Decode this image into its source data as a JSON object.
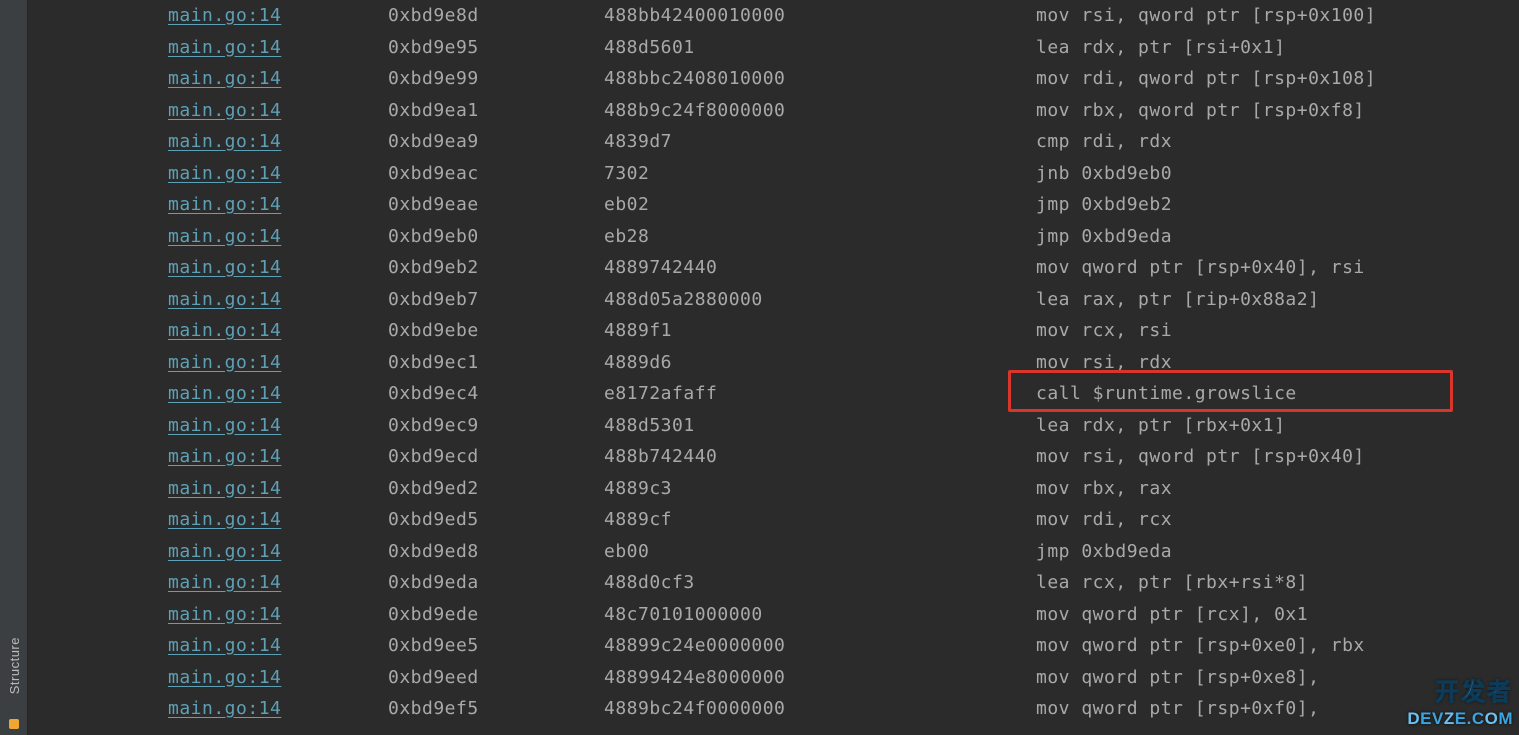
{
  "sidebar": {
    "structure_label": "Structure"
  },
  "highlight_row_index": 12,
  "rows": [
    {
      "src": "main.go:14",
      "addr": "0xbd9e8d",
      "bytes": "488bb42400010000",
      "asm": "mov rsi, qword ptr [rsp+0x100]"
    },
    {
      "src": "main.go:14",
      "addr": "0xbd9e95",
      "bytes": "488d5601",
      "asm": "lea rdx, ptr [rsi+0x1]"
    },
    {
      "src": "main.go:14",
      "addr": "0xbd9e99",
      "bytes": "488bbc2408010000",
      "asm": "mov rdi, qword ptr [rsp+0x108]"
    },
    {
      "src": "main.go:14",
      "addr": "0xbd9ea1",
      "bytes": "488b9c24f8000000",
      "asm": "mov rbx, qword ptr [rsp+0xf8]"
    },
    {
      "src": "main.go:14",
      "addr": "0xbd9ea9",
      "bytes": "4839d7",
      "asm": "cmp rdi, rdx"
    },
    {
      "src": "main.go:14",
      "addr": "0xbd9eac",
      "bytes": "7302",
      "asm": "jnb 0xbd9eb0"
    },
    {
      "src": "main.go:14",
      "addr": "0xbd9eae",
      "bytes": "eb02",
      "asm": "jmp 0xbd9eb2"
    },
    {
      "src": "main.go:14",
      "addr": "0xbd9eb0",
      "bytes": "eb28",
      "asm": "jmp 0xbd9eda"
    },
    {
      "src": "main.go:14",
      "addr": "0xbd9eb2",
      "bytes": "4889742440",
      "asm": "mov qword ptr [rsp+0x40], rsi"
    },
    {
      "src": "main.go:14",
      "addr": "0xbd9eb7",
      "bytes": "488d05a2880000",
      "asm": "lea rax, ptr [rip+0x88a2]"
    },
    {
      "src": "main.go:14",
      "addr": "0xbd9ebe",
      "bytes": "4889f1",
      "asm": "mov rcx, rsi"
    },
    {
      "src": "main.go:14",
      "addr": "0xbd9ec1",
      "bytes": "4889d6",
      "asm": "mov rsi, rdx"
    },
    {
      "src": "main.go:14",
      "addr": "0xbd9ec4",
      "bytes": "e8172afaff",
      "asm": "call $runtime.growslice"
    },
    {
      "src": "main.go:14",
      "addr": "0xbd9ec9",
      "bytes": "488d5301",
      "asm": "lea rdx, ptr [rbx+0x1]"
    },
    {
      "src": "main.go:14",
      "addr": "0xbd9ecd",
      "bytes": "488b742440",
      "asm": "mov rsi, qword ptr [rsp+0x40]"
    },
    {
      "src": "main.go:14",
      "addr": "0xbd9ed2",
      "bytes": "4889c3",
      "asm": "mov rbx, rax"
    },
    {
      "src": "main.go:14",
      "addr": "0xbd9ed5",
      "bytes": "4889cf",
      "asm": "mov rdi, rcx"
    },
    {
      "src": "main.go:14",
      "addr": "0xbd9ed8",
      "bytes": "eb00",
      "asm": "jmp 0xbd9eda"
    },
    {
      "src": "main.go:14",
      "addr": "0xbd9eda",
      "bytes": "488d0cf3",
      "asm": "lea rcx, ptr [rbx+rsi*8]"
    },
    {
      "src": "main.go:14",
      "addr": "0xbd9ede",
      "bytes": "48c70101000000",
      "asm": "mov qword ptr [rcx], 0x1"
    },
    {
      "src": "main.go:14",
      "addr": "0xbd9ee5",
      "bytes": "48899c24e0000000",
      "asm": "mov qword ptr [rsp+0xe0], rbx"
    },
    {
      "src": "main.go:14",
      "addr": "0xbd9eed",
      "bytes": "48899424e8000000",
      "asm": "mov qword ptr [rsp+0xe8], "
    },
    {
      "src": "main.go:14",
      "addr": "0xbd9ef5",
      "bytes": "4889bc24f0000000",
      "asm": "mov qword ptr [rsp+0xf0], "
    }
  ],
  "watermark": {
    "cn": "开发者",
    "url_prefix": "D",
    "url_mid": "EV",
    "url_prefix2": "Z",
    "url_mid2": "E",
    "url_dot": ".C",
    "url_mid3": "O",
    "url_end": "M"
  }
}
